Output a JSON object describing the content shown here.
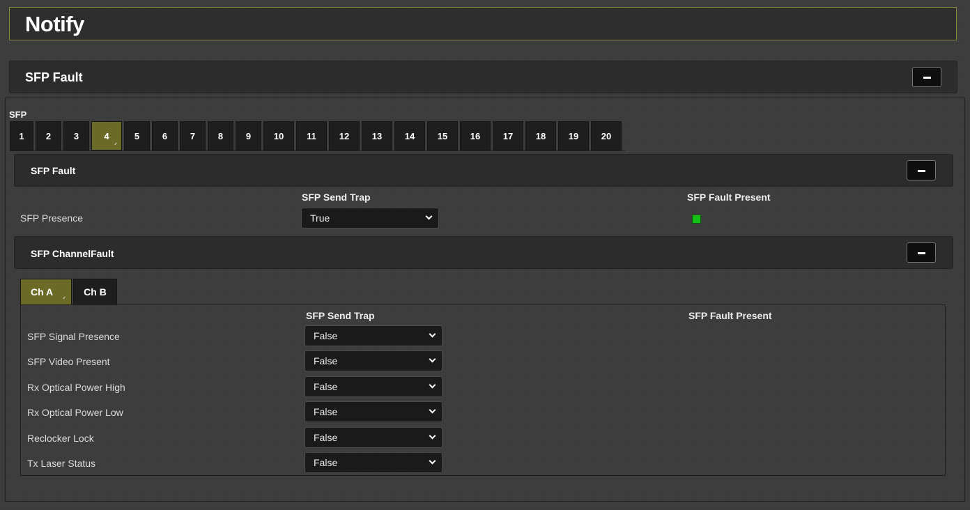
{
  "page": {
    "title": "Notify"
  },
  "sfp_fault_section": {
    "label": "SFP Fault"
  },
  "sfp_selector": {
    "caption": "SFP",
    "tabs": [
      "1",
      "2",
      "3",
      "4",
      "5",
      "6",
      "7",
      "8",
      "9",
      "10",
      "11",
      "12",
      "13",
      "14",
      "15",
      "16",
      "17",
      "18",
      "19",
      "20"
    ],
    "active_index": 3
  },
  "sfp_fault_sub": {
    "label": "SFP Fault",
    "col_send_trap": "SFP Send Trap",
    "col_fault_present": "SFP Fault Present",
    "row_label": "SFP Presence",
    "send_trap_value": "True",
    "fault_led_color": "#16c016"
  },
  "channel_fault": {
    "label": "SFP ChannelFault",
    "tabs": [
      "Ch A",
      "Ch B"
    ],
    "active_index": 0,
    "col_send_trap": "SFP Send Trap",
    "col_fault_present": "SFP Fault Present",
    "rows": [
      {
        "label": "SFP Signal Presence",
        "value": "False"
      },
      {
        "label": "SFP Video Present",
        "value": "False"
      },
      {
        "label": "Rx Optical Power High",
        "value": "False"
      },
      {
        "label": "Rx Optical Power Low",
        "value": "False"
      },
      {
        "label": "Reclocker Lock",
        "value": "False"
      },
      {
        "label": "Tx Laser Status",
        "value": "False"
      }
    ]
  },
  "colors": {
    "accent": "#6b6b27",
    "title_border": "#8a8a3a"
  }
}
